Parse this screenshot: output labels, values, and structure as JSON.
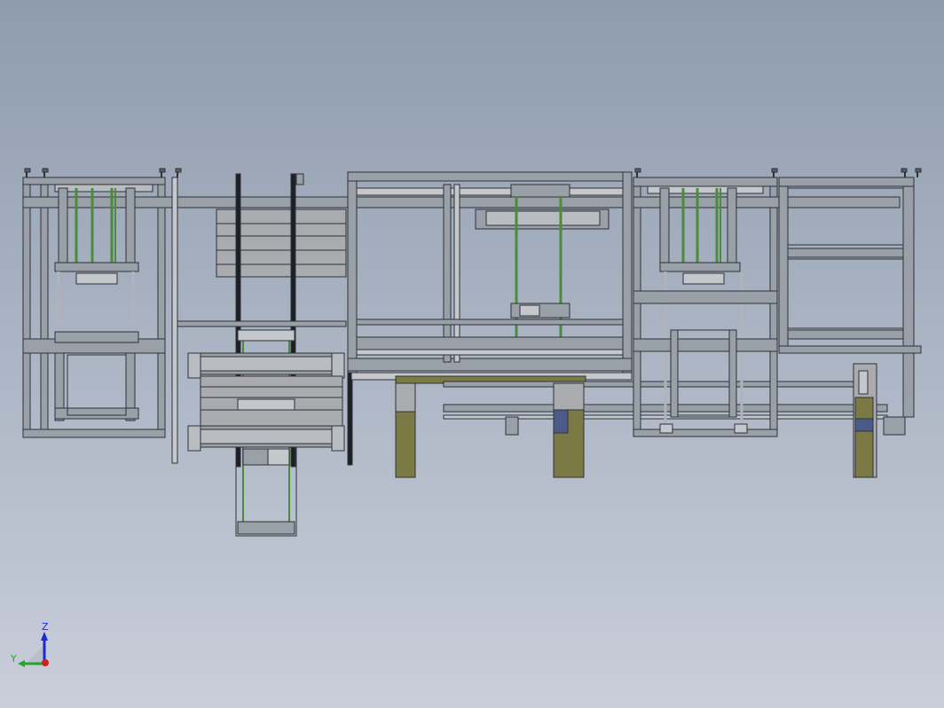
{
  "viewport": {
    "background_top": "#8e9cae",
    "background_bottom": "#c9ceda"
  },
  "colors": {
    "frame_dark": "#3a3f47",
    "frame_fill": "#9aa0a8",
    "frame_light": "#c4c7cc",
    "panel_fill": "#a9abae",
    "rail_green": "#4c8a3c",
    "olive": "#7b7a45",
    "navy": "#4b5a86",
    "black_post": "#1c1f24"
  },
  "triad": {
    "z_label": "Z",
    "y_label": "Y",
    "z_color": "#1c2ad6",
    "y_color": "#21a52a",
    "x_color": "#d21e1e"
  }
}
